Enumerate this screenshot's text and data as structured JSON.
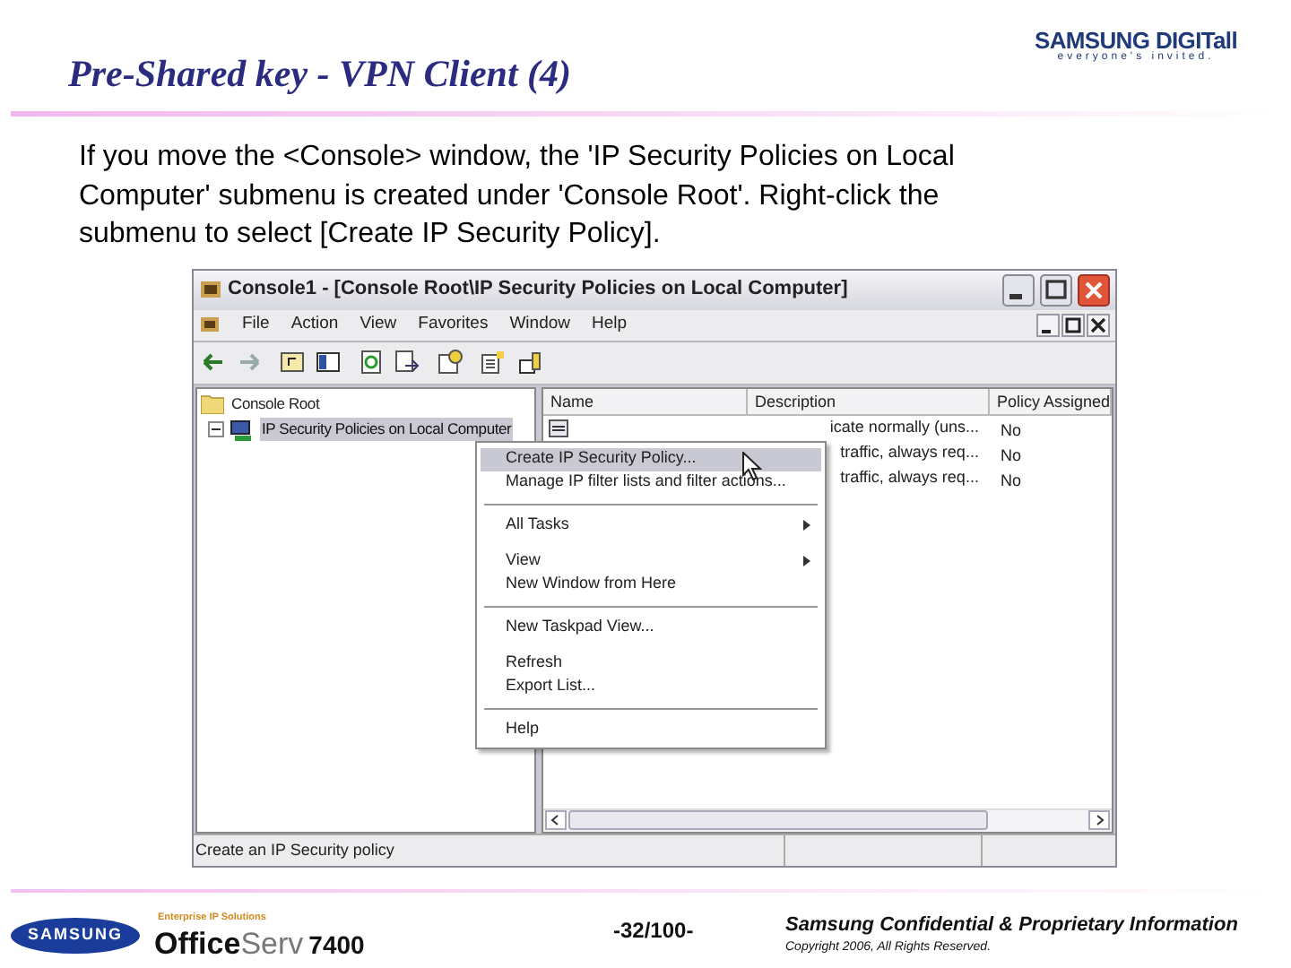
{
  "slide": {
    "title": "Pre-Shared key - VPN Client (4)",
    "logo": {
      "brand": "SAMSUNG DIGITall",
      "tagline": "everyone's invited."
    },
    "body": "If you move the <Console> window, the 'IP Security Policies on Local Computer' submenu is created under 'Console Root'. Right-click the submenu to select [Create IP Security Policy]."
  },
  "window": {
    "title": "Console1 - [Console Root\\IP Security Policies on Local Computer]",
    "menu": [
      "File",
      "Action",
      "View",
      "Favorites",
      "Window",
      "Help"
    ],
    "tree": [
      {
        "label": "Console Root",
        "selected": false,
        "children": [
          {
            "label": "IP Security Policies on Local Computer",
            "selected": true,
            "expanded": true
          }
        ]
      }
    ],
    "list": {
      "columns": [
        "Name",
        "Description",
        "Policy Assigned"
      ],
      "rows": [
        {
          "description": "icate normally (uns...",
          "assigned": "No"
        },
        {
          "description": "traffic, always req...",
          "assigned": "No"
        },
        {
          "description": "traffic, always req...",
          "assigned": "No"
        }
      ]
    },
    "context_menu": [
      {
        "kind": "item",
        "label": "Create IP Security Policy...",
        "selected": true,
        "submenu": false
      },
      {
        "kind": "item",
        "label": "Manage IP filter lists and filter actions...",
        "selected": false,
        "submenu": false
      },
      {
        "kind": "separator"
      },
      {
        "kind": "item",
        "label": "All Tasks",
        "selected": false,
        "submenu": true
      },
      {
        "kind": "gap"
      },
      {
        "kind": "item",
        "label": "View",
        "selected": false,
        "submenu": true
      },
      {
        "kind": "item",
        "label": "New Window from Here",
        "selected": false,
        "submenu": false
      },
      {
        "kind": "separator"
      },
      {
        "kind": "item",
        "label": "New Taskpad View...",
        "selected": false,
        "submenu": false
      },
      {
        "kind": "gap"
      },
      {
        "kind": "item",
        "label": "Refresh",
        "selected": false,
        "submenu": false
      },
      {
        "kind": "item",
        "label": "Export List...",
        "selected": false,
        "submenu": false
      },
      {
        "kind": "separator"
      },
      {
        "kind": "item",
        "label": "Help",
        "selected": false,
        "submenu": false
      }
    ],
    "status_bar": "Create an IP Security policy"
  },
  "footer": {
    "brand": "SAMSUNG",
    "product_tag": "Enterprise IP Solutions",
    "product": [
      "Office",
      "Serv",
      "7400"
    ],
    "page": "-32/100-",
    "notice": "Samsung Confidential & Proprietary Information",
    "copyright": "Copyright 2006, All Rights Reserved."
  }
}
